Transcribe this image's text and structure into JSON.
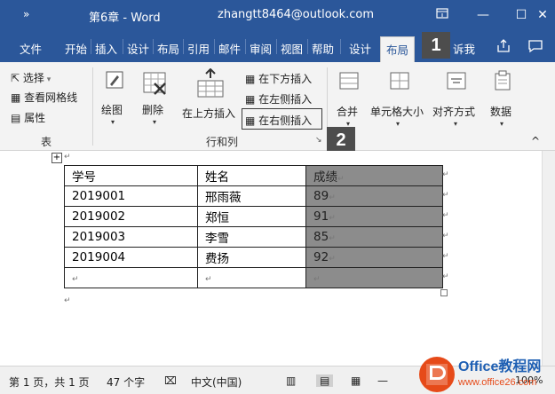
{
  "titlebar": {
    "quick_access": "»",
    "doc_title": "第6章 - Word",
    "account": "zhangtt8464@outlook.com",
    "ribbon_display_icon": "ribbon-display-icon",
    "minimize": "—",
    "maximize": "☐",
    "close": "✕"
  },
  "tabs": {
    "items": [
      "文件",
      "开始",
      "插入",
      "设计",
      "布局",
      "引用",
      "邮件",
      "审阅",
      "视图",
      "帮助",
      "设计",
      "布局"
    ],
    "active": "布局",
    "tell_me": "诉我",
    "share_icon": "share-icon",
    "comment_icon": "comment-icon"
  },
  "badges": {
    "one": "1",
    "two": "2"
  },
  "ribbon": {
    "table_group": {
      "select": "选择",
      "view_gridlines": "查看网格线",
      "properties": "属性",
      "label": "表"
    },
    "draw": "绘图",
    "delete": "删除",
    "rows_cols": {
      "insert_above": "在上方插入",
      "insert_below": "在下方插入",
      "insert_left": "在左侧插入",
      "insert_right": "在右侧插入",
      "label": "行和列",
      "launcher": "↘"
    },
    "merge": "合并",
    "cell_size": "单元格大小",
    "alignment": "对齐方式",
    "data": "数据",
    "collapse": "^"
  },
  "table": {
    "headers": [
      "学号",
      "姓名",
      "成绩"
    ],
    "rows": [
      [
        "2019001",
        "邢雨薇",
        "89"
      ],
      [
        "2019002",
        "郑恒",
        "91"
      ],
      [
        "2019003",
        "李雪",
        "85"
      ],
      [
        "2019004",
        "费扬",
        "92"
      ],
      [
        "",
        "",
        ""
      ]
    ],
    "cell_mark": "↵",
    "move_handle": "+"
  },
  "statusbar": {
    "page": "第 1 页，共 1 页",
    "words": "47 个字",
    "language": "中文(中国)",
    "zoom": "100%",
    "zoom_minus": "—"
  },
  "watermark": {
    "brand": "Office教程网",
    "url": "www.office26.com"
  }
}
